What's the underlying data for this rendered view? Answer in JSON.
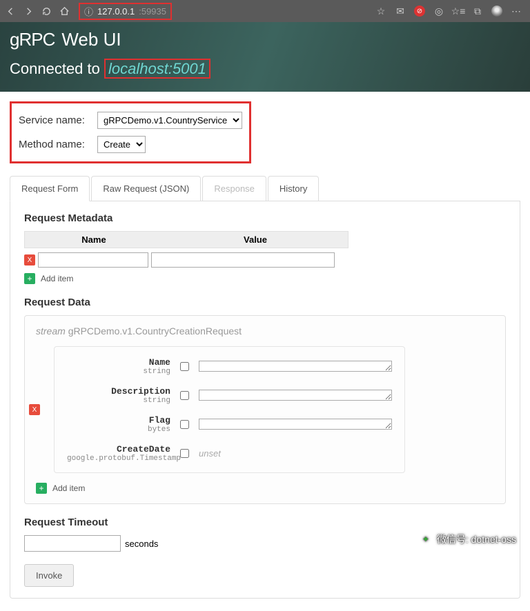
{
  "browser": {
    "url_host": "127.0.0.1",
    "url_port": ":59935"
  },
  "header": {
    "logo": "gRPC",
    "title": "Web UI",
    "connected_label": "Connected to",
    "host": "localhost:5001"
  },
  "service_form": {
    "service_label": "Service name:",
    "service_value": "gRPCDemo.v1.CountryService",
    "method_label": "Method name:",
    "method_value": "Create"
  },
  "tabs": {
    "request_form": "Request Form",
    "raw_request": "Raw Request (JSON)",
    "response": "Response",
    "history": "History"
  },
  "metadata": {
    "heading": "Request Metadata",
    "col_name": "Name",
    "col_value": "Value",
    "add_item": "Add item"
  },
  "data": {
    "heading": "Request Data",
    "stream_prefix": "stream",
    "stream_type": "gRPCDemo.v1.CountryCreationRequest",
    "fields": [
      {
        "name": "Name",
        "type": "string"
      },
      {
        "name": "Description",
        "type": "string"
      },
      {
        "name": "Flag",
        "type": "bytes"
      },
      {
        "name": "CreateDate",
        "type": "google.protobuf.Timestamp"
      }
    ],
    "unset": "unset",
    "add_item": "Add item"
  },
  "timeout": {
    "heading": "Request Timeout",
    "unit": "seconds"
  },
  "invoke": "Invoke",
  "watermark": "微信号: dotnet-oss"
}
